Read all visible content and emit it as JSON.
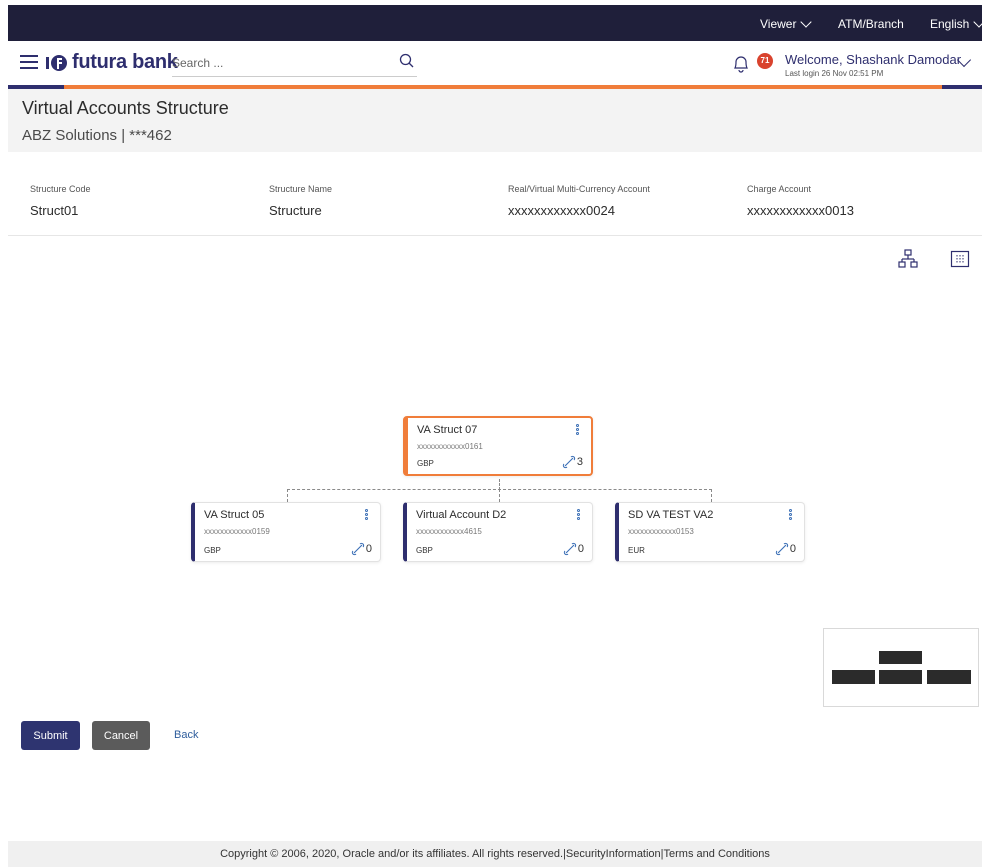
{
  "topbar": {
    "viewer_label": "Viewer",
    "atm_label": "ATM/Branch",
    "language_label": "English"
  },
  "header": {
    "brand": "futura bank",
    "search_placeholder": "Search ...",
    "notification_count": "71",
    "welcome": "Welcome, Shashank Damodar",
    "last_login": "Last login 26 Nov 02:51 PM"
  },
  "page": {
    "title": "Virtual Accounts Structure",
    "subtitle": "ABZ Solutions | ***462"
  },
  "details": {
    "structure_code_label": "Structure Code",
    "structure_code": "Struct01",
    "structure_name_label": "Structure Name",
    "structure_name": "Structure",
    "main_account_label": "Real/Virtual Multi-Currency Account",
    "main_account": "xxxxxxxxxxxx0024",
    "charge_account_label": "Charge Account",
    "charge_account": "xxxxxxxxxxxx0013"
  },
  "tree": {
    "root": {
      "name": "VA Struct 07",
      "account": "xxxxxxxxxxxx0161",
      "currency": "GBP",
      "links": "3"
    },
    "children": [
      {
        "name": "VA Struct 05",
        "account": "xxxxxxxxxxxx0159",
        "currency": "GBP",
        "links": "0"
      },
      {
        "name": "Virtual Account D2",
        "account": "xxxxxxxxxxxx4615",
        "currency": "GBP",
        "links": "0"
      },
      {
        "name": "SD VA TEST VA2",
        "account": "xxxxxxxxxxxx0153",
        "currency": "EUR",
        "links": "0"
      }
    ]
  },
  "actions": {
    "submit": "Submit",
    "cancel": "Cancel",
    "back": "Back"
  },
  "footer": {
    "copyright": "Copyright © 2006, 2020, Oracle and/or its affiliates. All rights reserved.",
    "sep1": "|",
    "security": "SecurityInformation",
    "sep2": "|",
    "terms": "Terms and Conditions"
  },
  "colors": {
    "brand_navy": "#2e2e6e",
    "accent_orange": "#f07d3a",
    "topbar": "#1f1f3a"
  }
}
